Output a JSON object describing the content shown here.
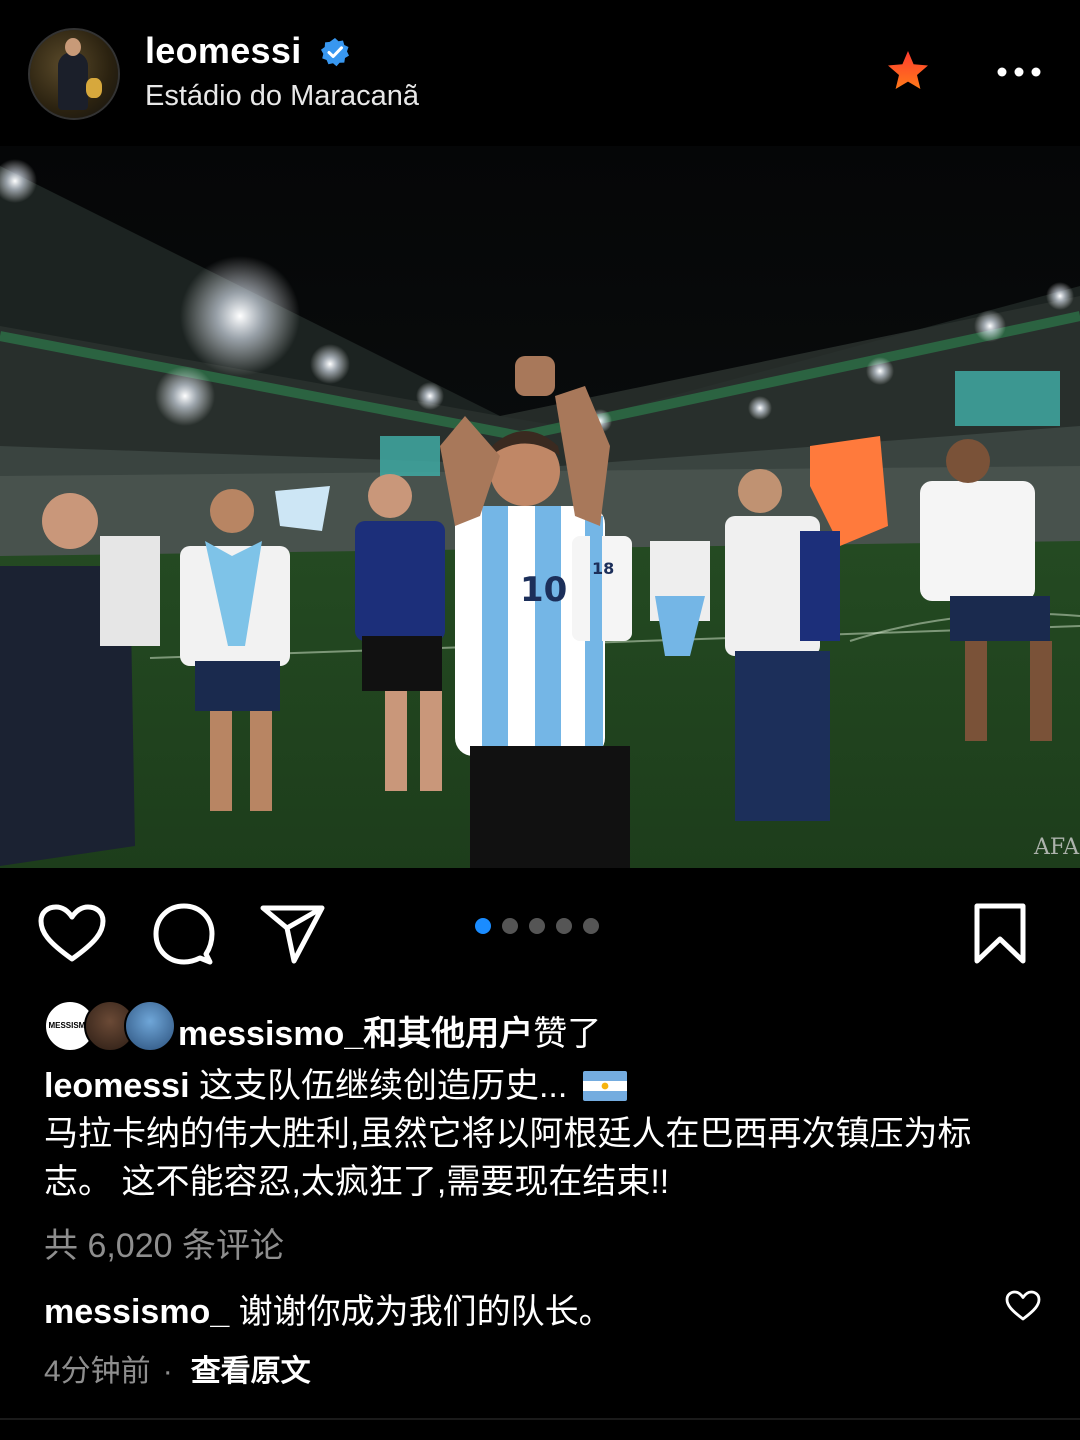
{
  "header": {
    "username": "leomessi",
    "location": "Estádio do Maracanã",
    "verified": true
  },
  "photo": {
    "jersey_number": "10",
    "jersey_number_2": "18",
    "watermark": "AFA"
  },
  "carousel": {
    "count": 5,
    "active_index": 0
  },
  "likes": {
    "avatar1_label": "MESSISMO",
    "user": "messismo_",
    "bold_text": "和其他用户",
    "plain_text": "赞了"
  },
  "caption": {
    "user": "leomessi",
    "line1": "这支队伍继续创造历史... ",
    "body": "马拉卡纳的伟大胜利,虽然它将以阿根廷人在巴西再次镇压为标志。 这不能容忍,太疯狂了,需要现在结束!!"
  },
  "comments": {
    "count_text": "共 6,020 条评论"
  },
  "top_comment": {
    "user": "messismo_",
    "text": " 谢谢你成为我们的队长。",
    "time": "4分钟前",
    "separator": "·",
    "see_original": "查看原文"
  },
  "colors": {
    "background": "#000000",
    "accent_blue": "#1a8cff",
    "muted": "#8e8e8e",
    "star_orange": "#ff5a1f"
  }
}
